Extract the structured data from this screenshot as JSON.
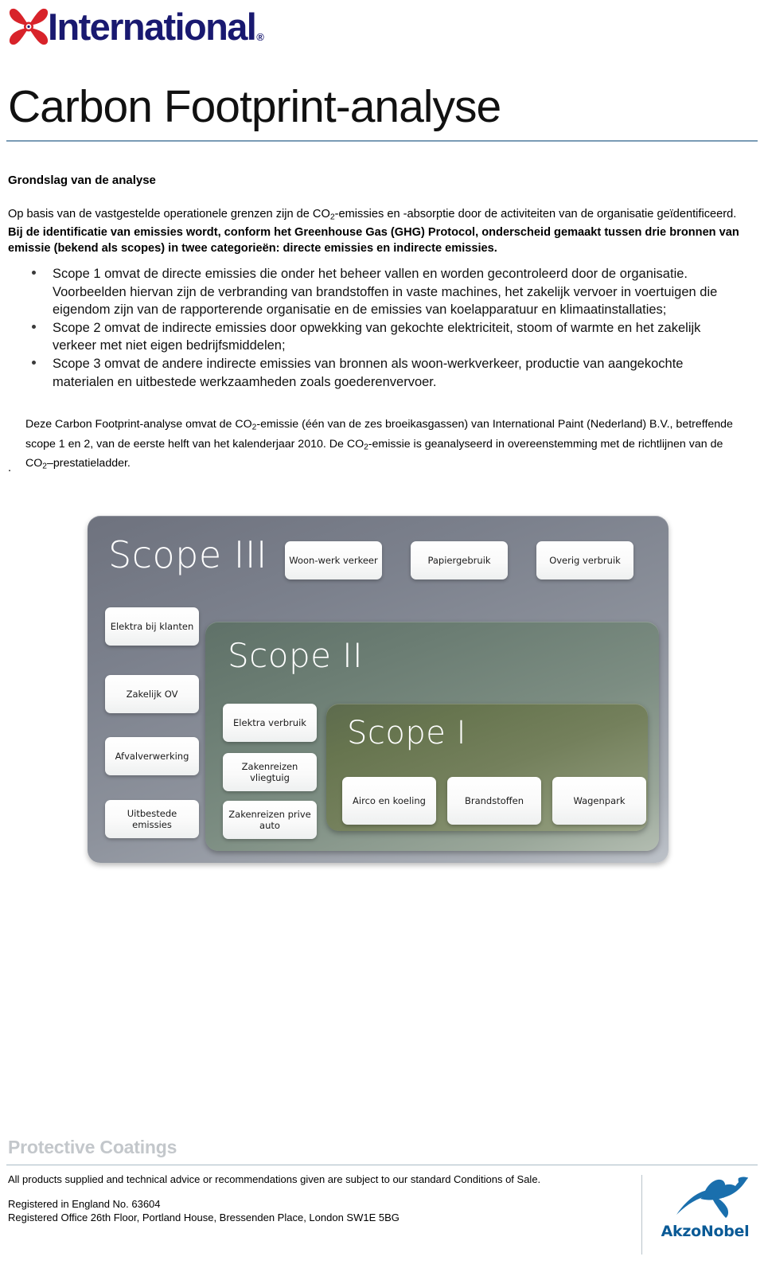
{
  "header": {
    "logo_icon": "propeller-icon",
    "logo_word": "International",
    "logo_registered": "®",
    "logo_color_mark": "#d8232a",
    "logo_color_word": "#191970"
  },
  "title": {
    "text": "Carbon Footprint-analyse",
    "rule_color": "#7a9bb5"
  },
  "section": {
    "heading": "Grondslag van de analyse"
  },
  "intro_paragraph": {
    "lead": "Op basis van de vastgestelde operationele grenzen zijn de CO",
    "lead_sub": "2",
    "lead_rest": "-emissies en -absorptie door de activiteiten van de organisatie geïdentificeerd. ",
    "bold_part": "Bij de identificatie van emissies wordt, conform het Greenhouse Gas (GHG) Protocol, onderscheid gemaakt tussen drie bronnen van emissie (bekend als scopes) in twee categorieën: directe emissies en indirecte emissies."
  },
  "bullets": [
    "Scope 1 omvat de directe emissies die onder het beheer vallen en worden gecontroleerd door de organisatie. Voorbeelden hiervan zijn de verbranding van brandstoffen in vaste machines, het zakelijk vervoer in voertuigen die eigendom zijn van de rapporterende organisatie en de emissies van koelapparatuur en klimaatinstallaties;",
    "Scope 2 omvat de  indirecte emissies door opwekking van gekochte elektriciteit, stoom of warmte en het zakelijk verkeer met niet eigen bedrijfsmiddelen;",
    "Scope 3 omvat de andere indirecte emissies van bronnen als woon-werkverkeer, productie van aangekochte materialen en uitbestede werkzaamheden zoals goederenvervoer."
  ],
  "closing_paragraph": {
    "p1a": "Deze Carbon Footprint-analyse omvat de CO",
    "p1a_sub": "2",
    "p1b": "-emissie (één van de zes broeikasgassen) van International Paint (Nederland) B.V., betreffende scope 1 en 2, van de eerste helft van het kalenderjaar 2010. De CO",
    "p1b_sub": "2",
    "p1c": "-emissie is geanalyseerd in overeenstemming met de richtlijnen van de CO",
    "p1c_sub": "2",
    "p1d": "–prestatieladder.",
    "trailing_dot": "."
  },
  "diagram": {
    "scope3": {
      "title": "Scope III",
      "color": "#7b808c",
      "top_row": [
        {
          "label": "Woon-werk verkeer"
        },
        {
          "label": "Papiergebruik"
        },
        {
          "label": "Overig verbruik"
        }
      ],
      "left_column": [
        {
          "label": "Elektra bij klanten"
        },
        {
          "label": "Zakelijk OV"
        },
        {
          "label": "Afvalverwerking"
        },
        {
          "label": "Uitbestede emissies"
        }
      ]
    },
    "scope2": {
      "title": "Scope II",
      "color": "#6b7d73",
      "items": [
        {
          "label": "Elektra verbruik"
        },
        {
          "label": "Zakenreizen vliegtuig"
        },
        {
          "label": "Zakenreizen prive auto"
        }
      ]
    },
    "scope1": {
      "title": "Scope I",
      "color": "#67754f",
      "items": [
        {
          "label": "Airco en koeling"
        },
        {
          "label": "Brandstoffen"
        },
        {
          "label": "Wagenpark"
        }
      ]
    }
  },
  "footer": {
    "brand": "Protective Coatings",
    "brand_color": "#c3c7cb",
    "rule_color": "#a9bcc6",
    "terms": "All products supplied and technical advice or recommendations given are subject to our standard Conditions of Sale.",
    "registered_no": "Registered in England No. 63604",
    "registered_office": "Registered Office 26th Floor, Portland House, Bressenden Place, London SW1E 5BG",
    "akzo_word": "AkzoNobel",
    "akzo_icon": "akzonobel-figure-icon",
    "akzo_color": "#0a5a96"
  }
}
